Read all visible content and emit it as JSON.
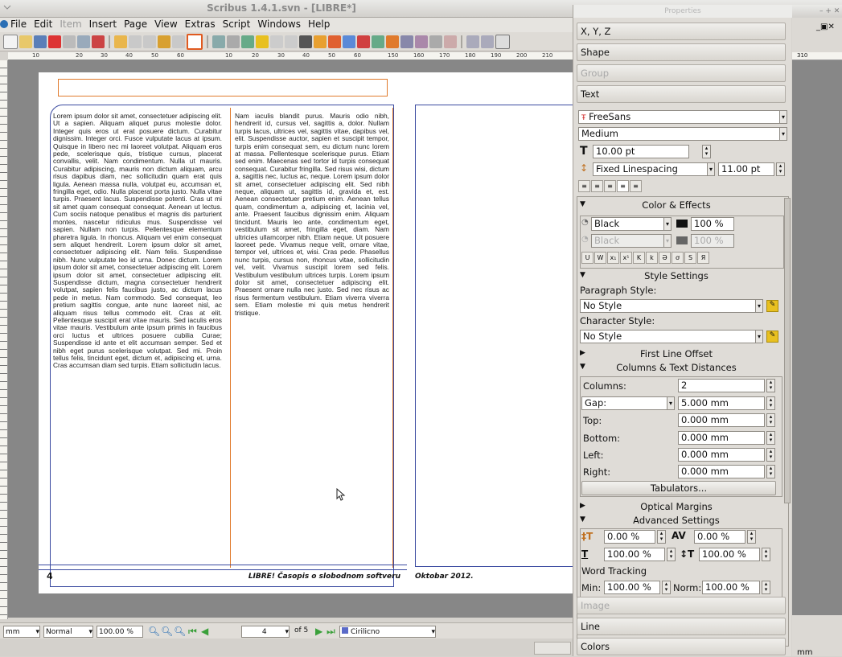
{
  "window": {
    "title": "Scribus 1.4.1.svn - [LIBRE*]"
  },
  "menus": [
    "File",
    "Edit",
    "Item",
    "Insert",
    "Page",
    "View",
    "Extras",
    "Script",
    "Windows",
    "Help"
  ],
  "menus_disabled": [
    "Item"
  ],
  "ruler_top": [
    "10",
    "20",
    "30",
    "40",
    "50",
    "60",
    "10",
    "20",
    "30",
    "40",
    "50",
    "60",
    "150",
    "160",
    "170",
    "180",
    "190",
    "200",
    "210"
  ],
  "ruler_right": "310",
  "document": {
    "col1": "Lorem ipsum dolor sit amet, consectetuer adipiscing elit. Ut a sapien. Aliquam aliquet purus molestie dolor. Integer quis eros ut erat posuere dictum. Curabitur dignissim. Integer orci. Fusce vulputate lacus at ipsum. Quisque in libero nec mi laoreet volutpat. Aliquam eros pede, scelerisque quis, tristique cursus, placerat convallis, velit. Nam condimentum. Nulla ut mauris. Curabitur adipiscing, mauris non dictum aliquam, arcu risus dapibus diam, nec sollicitudin quam erat quis ligula. Aenean massa nulla, volutpat eu, accumsan et, fringilla eget, odio. Nulla placerat porta justo. Nulla vitae turpis. Praesent lacus. Suspendisse potenti. Cras ut mi sit amet quam consequat consequat. Aenean ut lectus. Cum sociis natoque penatibus et magnis dis parturient montes, nascetur ridiculus mus. Suspendisse vel sapien. Nullam non turpis. Pellentesque elementum pharetra ligula. In rhoncus. Aliquam vel enim consequat sem aliquet hendrerit. Lorem ipsum dolor sit amet, consectetuer adipiscing elit. Nam felis. Suspendisse nibh. Nunc vulputate leo id urna. Donec dictum. Lorem ipsum dolor sit amet, consectetuer adipiscing elit. Lorem ipsum dolor sit amet, consectetuer adipiscing elit. Suspendisse dictum, magna consectetuer hendrerit volutpat, sapien felis faucibus justo, ac dictum lacus pede in metus. Nam commodo. Sed consequat, leo pretium sagittis congue, ante nunc laoreet nisl, ac aliquam risus tellus commodo elit. Cras at elit. Pellentesque suscipit erat vitae mauris. Sed iaculis eros vitae mauris. Vestibulum ante ipsum primis in faucibus orci luctus et ultrices posuere cubilia Curae; Suspendisse id ante et elit accumsan semper. Sed et nibh eget purus scelerisque volutpat. Sed mi. Proin tellus felis, tincidunt eget, dictum et, adipiscing et, urna. Cras accumsan diam sed turpis. Etiam sollicitudin lacus.",
    "col2": "Nam iaculis blandit purus. Mauris odio nibh, hendrerit id, cursus vel, sagittis a, dolor. Nullam turpis lacus, ultrices vel, sagittis vitae, dapibus vel, elit. Suspendisse auctor, sapien et suscipit tempor, turpis enim consequat sem, eu dictum nunc lorem at massa. Pellentesque scelerisque purus. Etiam sed enim. Maecenas sed tortor id turpis consequat consequat. Curabitur fringilla. Sed risus wisi, dictum a, sagittis nec, luctus ac, neque. Lorem ipsum dolor sit amet, consectetuer adipiscing elit. Sed nibh neque, aliquam ut, sagittis id, gravida et, est. Aenean consectetuer pretium enim. Aenean tellus quam, condimentum a, adipiscing et, lacinia vel, ante. Praesent faucibus dignissim enim. Aliquam tincidunt. Mauris leo ante, condimentum eget, vestibulum sit amet, fringilla eget, diam. Nam ultricies ullamcorper nibh. Etiam neque. Ut posuere laoreet pede. Vivamus neque velit, ornare vitae, tempor vel, ultrices et, wisi. Cras pede. Phasellus nunc turpis, cursus non, rhoncus vitae, sollicitudin vel, velit. Vivamus suscipit lorem sed felis. Vestibulum vestibulum ultrices turpis. Lorem ipsum dolor sit amet, consectetuer adipiscing elit. Praesent ornare nulla nec justo. Sed nec risus ac risus fermentum vestibulum. Etiam viverra viverra sem. Etiam molestie mi quis metus hendrerit tristique.",
    "page_number": "4",
    "footer_left": "LIBRE! Časopis o slobodnom softveru",
    "footer_right": "Oktobar 2012."
  },
  "status": {
    "unit": "mm",
    "mode": "Normal",
    "zoom": "100.00 %",
    "page": "4",
    "of_pages": "of 5",
    "layer": "Cirilicno",
    "coord_unit": "mm"
  },
  "panel": {
    "title": "Properties",
    "sections": {
      "xyz": "X, Y, Z",
      "shape": "Shape",
      "group": "Group",
      "text": "Text",
      "image": "Image",
      "line": "Line",
      "colors": "Colors"
    },
    "font": "FreeSans",
    "font_style": "Medium",
    "font_size": "10.00 pt",
    "linespacing_mode": "Fixed Linespacing",
    "linespacing": "11.00 pt",
    "color_effects": "Color & Effects",
    "fill_color": "Black",
    "fill_shade": "100 %",
    "stroke_color": "Black",
    "stroke_shade": "100 %",
    "style_settings": "Style Settings",
    "paragraph_style_label": "Paragraph Style:",
    "paragraph_style": "No Style",
    "character_style_label": "Character Style:",
    "character_style": "No Style",
    "first_line_offset": "First Line Offset",
    "columns_text_distances": "Columns & Text Distances",
    "columns_label": "Columns:",
    "columns": "2",
    "gap_label": "Gap:",
    "gap": "5.000 mm",
    "top_label": "Top:",
    "top": "0.000 mm",
    "bottom_label": "Bottom:",
    "bottom": "0.000 mm",
    "left_label": "Left:",
    "left": "0.000 mm",
    "right_label": "Right:",
    "right": "0.000 mm",
    "tabulators": "Tabulators...",
    "optical_margins": "Optical Margins",
    "advanced_settings": "Advanced Settings",
    "baseline_offset": "0.00 %",
    "tracking": "0.00 %",
    "scale_h": "100.00 %",
    "scale_v": "100.00 %",
    "word_tracking_label": "Word Tracking",
    "min_label": "Min:",
    "min": "100.00 %",
    "norm_label": "Norm:",
    "norm": "100.00 %"
  },
  "colors": {
    "margin_guide": "#e07a2c",
    "frame_blue": "#3a4aa0",
    "panel_bg": "#dfdcd7"
  }
}
